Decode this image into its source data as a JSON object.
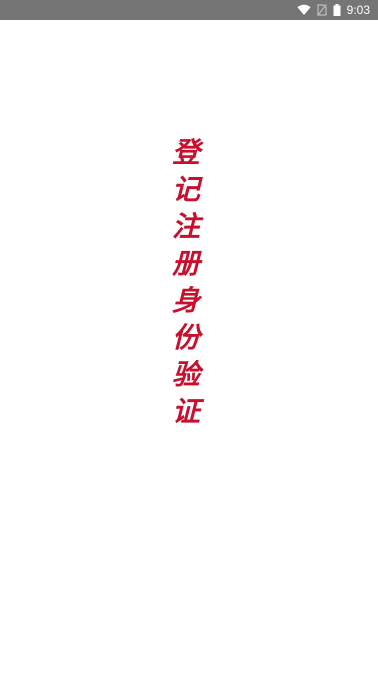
{
  "status_bar": {
    "time": "9:03",
    "icons": [
      "wifi-icon",
      "no-sim-icon",
      "battery-icon"
    ]
  },
  "splash": {
    "title_chars": [
      "登",
      "记",
      "注",
      "册",
      "身",
      "份",
      "验",
      "证"
    ],
    "title_color": "#c8102e"
  }
}
